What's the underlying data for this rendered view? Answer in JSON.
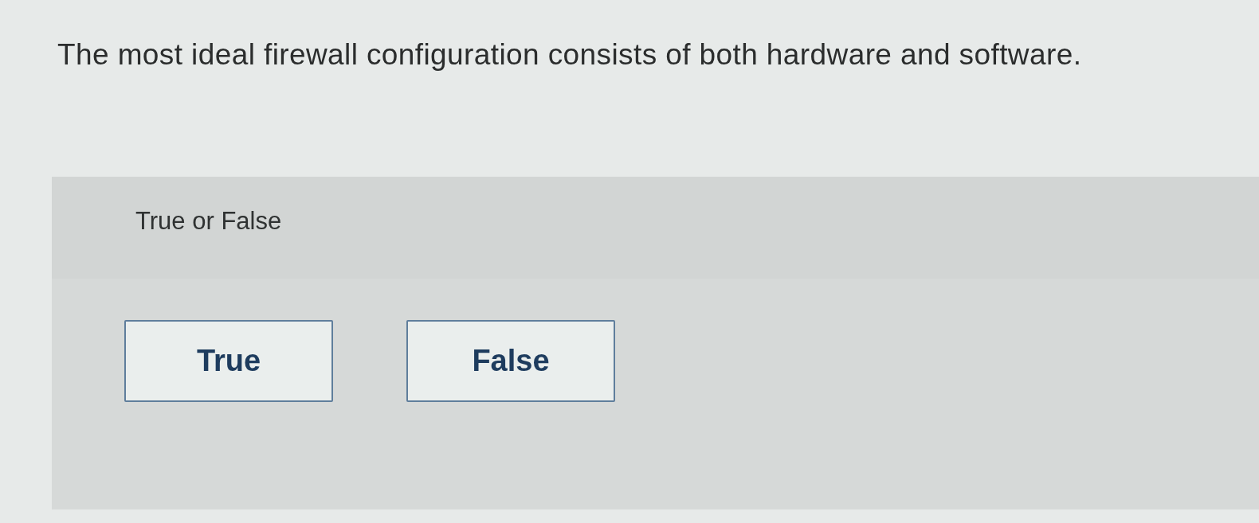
{
  "question": "The most ideal firewall configuration consists of both hardware and software.",
  "prompt": "True or False",
  "options": [
    {
      "label": "True",
      "selected": false
    },
    {
      "label": "False",
      "selected": false
    }
  ]
}
